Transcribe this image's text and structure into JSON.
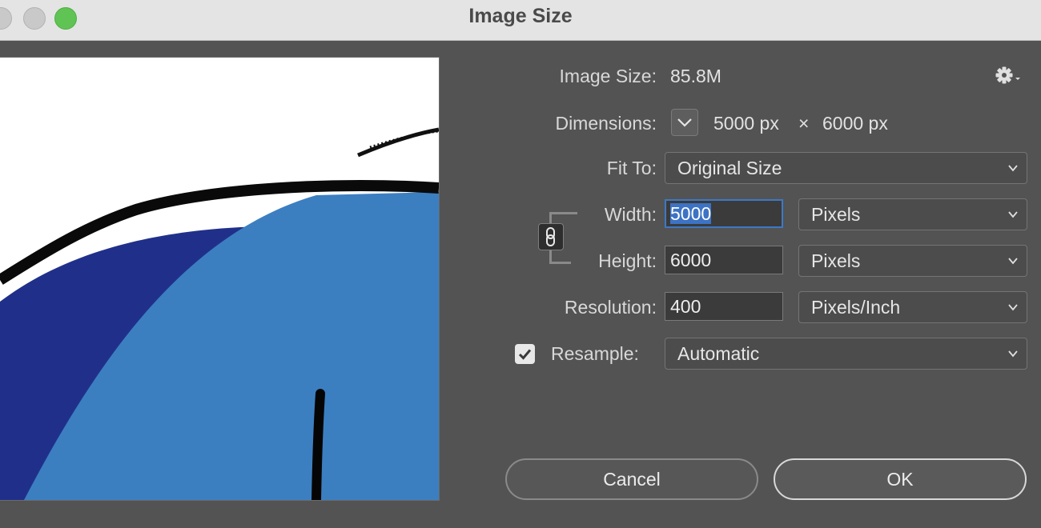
{
  "window": {
    "title": "Image Size"
  },
  "info": {
    "image_size_label": "Image Size:",
    "image_size_value": "85.8M",
    "dimensions_label": "Dimensions:",
    "dim_width": "5000 px",
    "dim_times": "×",
    "dim_height": "6000 px"
  },
  "fit_to": {
    "label": "Fit To:",
    "value": "Original Size"
  },
  "width": {
    "label": "Width:",
    "value": "5000",
    "unit": "Pixels"
  },
  "height": {
    "label": "Height:",
    "value": "6000",
    "unit": "Pixels"
  },
  "resolution": {
    "label": "Resolution:",
    "value": "400",
    "unit": "Pixels/Inch"
  },
  "resample": {
    "label": "Resample:",
    "checked": true,
    "value": "Automatic"
  },
  "buttons": {
    "cancel": "Cancel",
    "ok": "OK"
  },
  "icons": {
    "settings": "gear-icon",
    "dimensions_toggle": "chevron-down-icon",
    "constrain": "link-chain-icon",
    "checkmark": "checkmark-icon"
  },
  "colors": {
    "dialog_bg": "#535353",
    "focus_accent": "#3d78c7",
    "traffic_green": "#5fc453",
    "preview_dark_blue": "#20308a",
    "preview_light_blue": "#3b7fc1"
  }
}
